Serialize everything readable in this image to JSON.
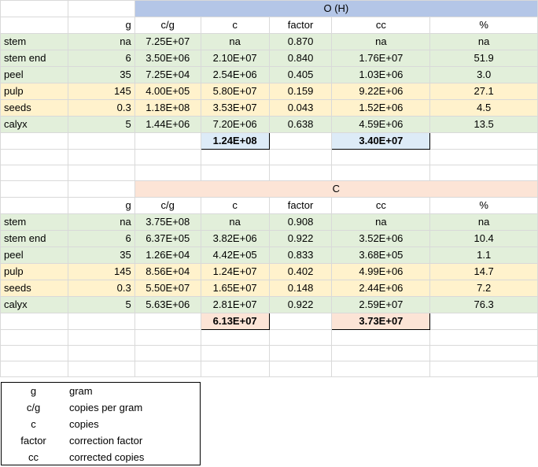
{
  "sections": [
    {
      "title": "O (H)",
      "color": "#b4c6e7",
      "headers": [
        "",
        "g",
        "c/g",
        "c",
        "factor",
        "cc",
        "%"
      ],
      "rows": [
        {
          "label": "stem",
          "g": "na",
          "cg": "7.25E+07",
          "c": "na",
          "factor": "0.870",
          "cc": "na",
          "pct": "na",
          "band": "green"
        },
        {
          "label": "stem end",
          "g": "6",
          "cg": "3.50E+06",
          "c": "2.10E+07",
          "factor": "0.840",
          "cc": "1.76E+07",
          "pct": "51.9",
          "band": "green"
        },
        {
          "label": "peel",
          "g": "35",
          "cg": "7.25E+04",
          "c": "2.54E+06",
          "factor": "0.405",
          "cc": "1.03E+06",
          "pct": "3.0",
          "band": "green"
        },
        {
          "label": "pulp",
          "g": "145",
          "cg": "4.00E+05",
          "c": "5.80E+07",
          "factor": "0.159",
          "cc": "9.22E+06",
          "pct": "27.1",
          "band": "yellow"
        },
        {
          "label": "seeds",
          "g": "0.3",
          "cg": "1.18E+08",
          "c": "3.53E+07",
          "factor": "0.043",
          "cc": "1.52E+06",
          "pct": "4.5",
          "band": "yellow"
        },
        {
          "label": "calyx",
          "g": "5",
          "cg": "1.44E+06",
          "c": "7.20E+06",
          "factor": "0.638",
          "cc": "4.59E+06",
          "pct": "13.5",
          "band": "green"
        }
      ],
      "total_c": "1.24E+08",
      "total_cc": "3.40E+07"
    },
    {
      "title": "C",
      "color": "#fce4d6",
      "headers": [
        "",
        "g",
        "c/g",
        "c",
        "factor",
        "cc",
        "%"
      ],
      "rows": [
        {
          "label": "stem",
          "g": "na",
          "cg": "3.75E+08",
          "c": "na",
          "factor": "0.908",
          "cc": "na",
          "pct": "na",
          "band": "green"
        },
        {
          "label": "stem end",
          "g": "6",
          "cg": "6.37E+05",
          "c": "3.82E+06",
          "factor": "0.922",
          "cc": "3.52E+06",
          "pct": "10.4",
          "band": "green"
        },
        {
          "label": "peel",
          "g": "35",
          "cg": "1.26E+04",
          "c": "4.42E+05",
          "factor": "0.833",
          "cc": "3.68E+05",
          "pct": "1.1",
          "band": "green"
        },
        {
          "label": "pulp",
          "g": "145",
          "cg": "8.56E+04",
          "c": "1.24E+07",
          "factor": "0.402",
          "cc": "4.99E+06",
          "pct": "14.7",
          "band": "yellow"
        },
        {
          "label": "seeds",
          "g": "0.3",
          "cg": "5.50E+07",
          "c": "1.65E+07",
          "factor": "0.148",
          "cc": "2.44E+06",
          "pct": "7.2",
          "band": "yellow"
        },
        {
          "label": "calyx",
          "g": "5",
          "cg": "5.63E+06",
          "c": "2.81E+07",
          "factor": "0.922",
          "cc": "2.59E+07",
          "pct": "76.3",
          "band": "green"
        }
      ],
      "total_c": "6.13E+07",
      "total_cc": "3.73E+07"
    }
  ],
  "legend": [
    {
      "abbr": "g",
      "desc": "gram"
    },
    {
      "abbr": "c/g",
      "desc": "copies per gram"
    },
    {
      "abbr": "c",
      "desc": "copies"
    },
    {
      "abbr": "factor",
      "desc": "correction factor"
    },
    {
      "abbr": "cc",
      "desc": "corrected copies"
    }
  ]
}
